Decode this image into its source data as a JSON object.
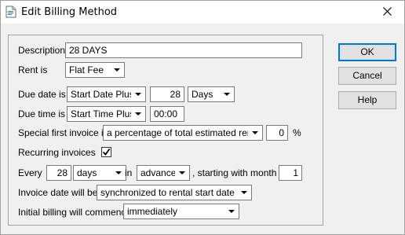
{
  "window": {
    "title": "Edit Billing Method"
  },
  "buttons": {
    "ok": "OK",
    "cancel": "Cancel",
    "help": "Help"
  },
  "form": {
    "description_label": "Description",
    "description_value": "28 DAYS",
    "rent_label": "Rent is",
    "rent_value": "Flat Fee",
    "due_date_label": "Due date is",
    "due_date_basis": "Start Date Plus",
    "due_date_amount": "28",
    "due_date_unit": "Days",
    "due_time_label": "Due time is",
    "due_time_basis": "Start Time Plus",
    "due_time_value": "00:00",
    "special_invoice_label": "Special first invoice is",
    "special_invoice_value": "a percentage of total estimated rent",
    "special_invoice_percent": "0",
    "percent_sign": "%",
    "recurring_label": "Recurring invoices",
    "recurring_checked": true,
    "every_label": "Every",
    "every_amount": "28",
    "every_unit": "days",
    "in_label": "in",
    "in_value": "advance",
    "starting_label": ", starting with month",
    "starting_month": "1",
    "invoice_date_label": "Invoice date will be",
    "invoice_date_value": "synchronized to rental start date",
    "initial_billing_label": "Initial billing will commence",
    "initial_billing_value": "immediately"
  }
}
